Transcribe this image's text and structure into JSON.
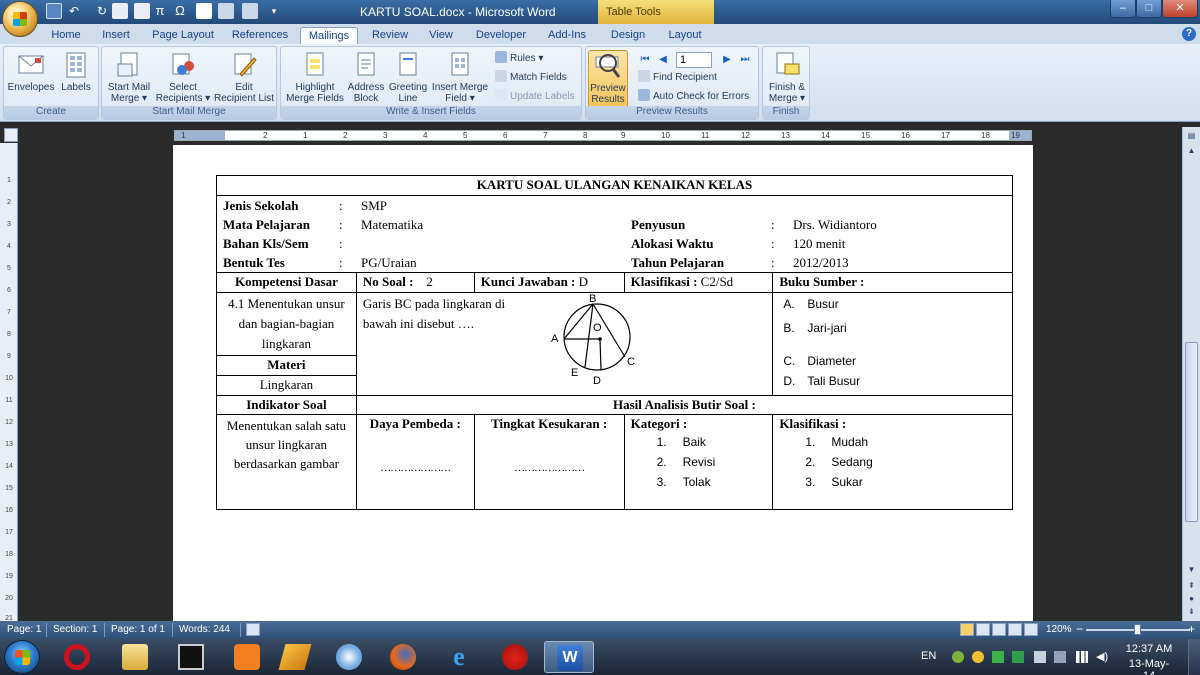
{
  "window": {
    "title": "KARTU SOAL.docx - Microsoft Word",
    "contextual_tab_group": "Table Tools",
    "controls": [
      "–",
      "□",
      "✕"
    ]
  },
  "tabs": [
    "Home",
    "Insert",
    "Page Layout",
    "References",
    "Mailings",
    "Review",
    "View",
    "Developer",
    "Add-Ins",
    "Design",
    "Layout"
  ],
  "active_tab": "Mailings",
  "ribbon": {
    "create": {
      "label": "Create",
      "envelopes": "Envelopes",
      "labels": "Labels"
    },
    "start_mail_merge": {
      "label": "Start Mail Merge",
      "start_l1": "Start Mail",
      "start_l2": "Merge ▾",
      "select_l1": "Select",
      "select_l2": "Recipients ▾",
      "edit_l1": "Edit",
      "edit_l2": "Recipient List"
    },
    "write_insert": {
      "label": "Write & Insert Fields",
      "highlight_l1": "Highlight",
      "highlight_l2": "Merge Fields",
      "address_l1": "Address",
      "address_l2": "Block",
      "greeting_l1": "Greeting",
      "greeting_l2": "Line",
      "insert_l1": "Insert Merge",
      "insert_l2": "Field ▾",
      "rules": "Rules ▾",
      "match_fields": "Match Fields",
      "update_labels": "Update Labels"
    },
    "preview": {
      "label": "Preview Results",
      "preview_l1": "Preview",
      "preview_l2": "Results",
      "record_value": "1",
      "find_recipient": "Find Recipient",
      "auto_check": "Auto Check for Errors"
    },
    "finish": {
      "label": "Finish",
      "finish_l1": "Finish &",
      "finish_l2": "Merge ▾"
    }
  },
  "ruler": {
    "ticks": [
      "1",
      "2",
      "1",
      "2",
      "3",
      "4",
      "5",
      "6",
      "7",
      "8",
      "9",
      "10",
      "11",
      "12",
      "13",
      "14",
      "15",
      "16",
      "17",
      "18",
      "19"
    ],
    "vticks": [
      "1",
      "2",
      "3",
      "4",
      "5",
      "6",
      "7",
      "8",
      "9",
      "10",
      "11",
      "12",
      "13",
      "14",
      "15",
      "16",
      "17",
      "18",
      "19",
      "20",
      "21"
    ]
  },
  "document": {
    "title": "KARTU SOAL ULANGAN KENAIKAN KELAS",
    "colon": ":",
    "jenis_sekolah_label": "Jenis Sekolah",
    "jenis_sekolah": "SMP",
    "mapel_label": "Mata Pelajaran",
    "mapel": "Matematika",
    "penyusun_label": "Penyusun",
    "penyusun": "Drs. Widiantoro",
    "bahan_label": "Bahan Kls/Sem",
    "bahan": "",
    "alokasi_label": "Alokasi Waktu",
    "alokasi": "120 menit",
    "bentuk_label": "Bentuk Tes",
    "bentuk": "PG/Uraian",
    "tahun_label": "Tahun Pelajaran",
    "tahun": "2012/2013",
    "kompetensi_header": "Kompetensi Dasar",
    "no_soal_label": "No Soal :",
    "no_soal": "2",
    "kunci_label": "Kunci Jawaban :",
    "kunci": "D",
    "klasifikasi_top_label": "Klasifikasi :",
    "klasifikasi_top": "C2/Sd",
    "buku_sumber": "Buku Sumber :",
    "kompetensi_text": "4.1 Menentukan unsur dan bagian-bagian lingkaran",
    "soal_text": "Garis BC pada lingkaran  di bawah ini  disebut ….",
    "circle_labels": {
      "B": "B",
      "A": "A",
      "O": "O",
      "C": "C",
      "E": "E",
      "D": "D"
    },
    "options": [
      {
        "letter": "A.",
        "text": "Busur"
      },
      {
        "letter": "B.",
        "text": "Jari-jari"
      },
      {
        "letter": "C.",
        "text": "Diameter"
      },
      {
        "letter": "D.",
        "text": "Tali Busur"
      }
    ],
    "materi_header": "Materi",
    "materi": "Lingkaran",
    "indikator_header": "Indikator Soal",
    "hasil_header": "Hasil Analisis Butir Soal :",
    "indikator_text": "Menentukan salah satu unsur lingkaran berdasarkan gambar",
    "daya_pembeda": "Daya Pembeda :",
    "tingkat_kesukaran": "Tingkat Kesukaran :",
    "dots": "…………………",
    "kategori": "Kategori :",
    "kategori_items": [
      {
        "n": "1.",
        "t": "Baik"
      },
      {
        "n": "2.",
        "t": "Revisi"
      },
      {
        "n": "3.",
        "t": "Tolak"
      }
    ],
    "klasifikasi_bottom": "Klasifikasi :",
    "klasifikasi_items": [
      {
        "n": "1.",
        "t": "Mudah"
      },
      {
        "n": "2.",
        "t": "Sedang"
      },
      {
        "n": "3.",
        "t": "Sukar"
      }
    ]
  },
  "status": {
    "page": "Page: 1",
    "section": "Section: 1",
    "page_of": "Page: 1 of 1",
    "words": "Words: 244",
    "zoom": "120%",
    "zoom_minus": "−",
    "zoom_plus": "+"
  },
  "taskbar": {
    "apps": [
      "opera-icon",
      "explorer-icon",
      "cmd-icon",
      "xampp-icon",
      "winamp-icon",
      "paint-icon",
      "firefox-icon",
      "ie-icon",
      "angry-birds-icon",
      "word-icon"
    ],
    "lang": "EN",
    "time": "12:37 AM",
    "date": "13-May-14"
  },
  "colors": {
    "ribbon_bg": "#dbe6f4",
    "title_bg": "#2f5e94",
    "table_tools": "#f0c84a",
    "taskbar": "#25324a"
  }
}
